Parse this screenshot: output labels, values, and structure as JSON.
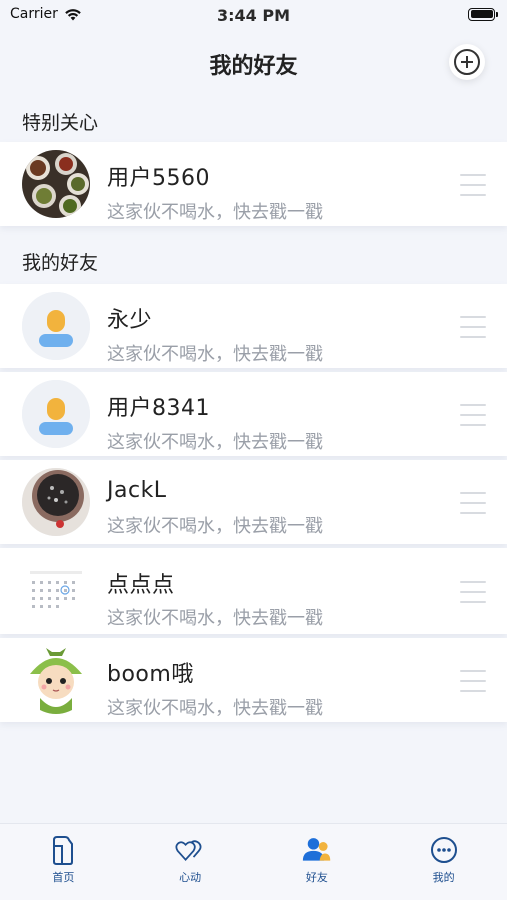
{
  "status_bar": {
    "carrier": "Carrier",
    "time": "3:44 PM"
  },
  "nav": {
    "title": "我的好友"
  },
  "sections": {
    "special": "特别关心",
    "friends": "我的好友"
  },
  "special_friends": [
    {
      "name": "用户5560",
      "status": "这家伙不喝水，快去戳一戳",
      "avatar": "food-photo-avatar"
    }
  ],
  "friends": [
    {
      "name": "永少",
      "status": "这家伙不喝水，快去戳一戳",
      "avatar": "default-user-avatar"
    },
    {
      "name": "用户8341",
      "status": "这家伙不喝水，快去戳一戳",
      "avatar": "default-user-avatar"
    },
    {
      "name": "JackL",
      "status": "这家伙不喝水，快去戳一戳",
      "avatar": "dark-photo-avatar"
    },
    {
      "name": "点点点",
      "status": "这家伙不喝水，快去戳一戳",
      "avatar": "calendar-avatar"
    },
    {
      "name": "boom哦",
      "status": "这家伙不喝水，快去戳一戳",
      "avatar": "cartoon-avatar"
    }
  ],
  "tabs": [
    {
      "label": "首页",
      "icon": "cup-icon"
    },
    {
      "label": "心动",
      "icon": "hearts-icon"
    },
    {
      "label": "好友",
      "icon": "friends-icon",
      "active": true
    },
    {
      "label": "我的",
      "icon": "smiley-icon"
    }
  ],
  "colors": {
    "accent": "#1e6fd9",
    "tab_text": "#1e4f8f",
    "background": "#f3f5fa"
  }
}
